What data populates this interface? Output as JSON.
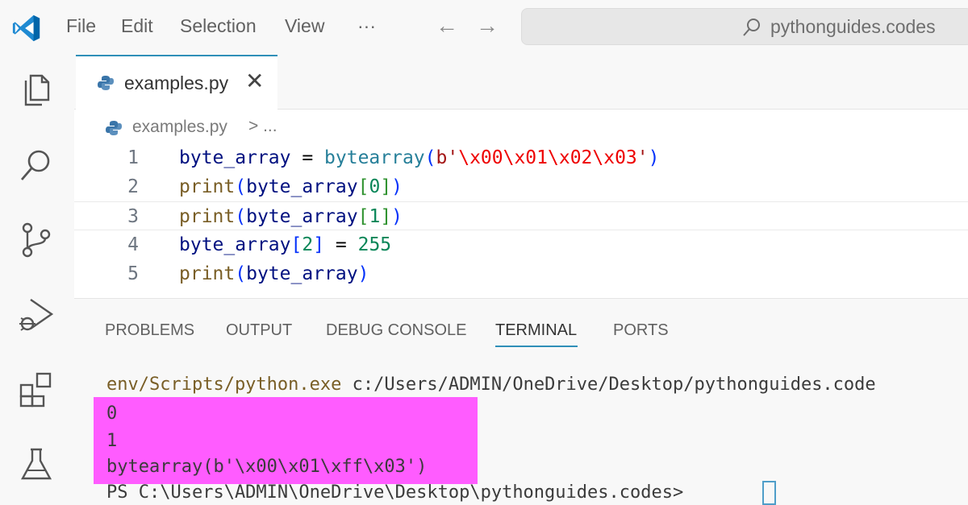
{
  "titlebar": {
    "menu": [
      "File",
      "Edit",
      "Selection",
      "View",
      "···"
    ],
    "back_icon": "←",
    "forward_icon": "→",
    "search_text": "pythonguides.codes"
  },
  "activity_icons": [
    "explorer-icon",
    "search-icon",
    "source-control-icon",
    "run-debug-icon",
    "extensions-icon",
    "testing-icon"
  ],
  "editor": {
    "tab_label": "examples.py",
    "tab_close": "✕",
    "breadcrumb_file": "examples.py",
    "breadcrumb_sep": "> ...",
    "lines": [
      {
        "num": "1"
      },
      {
        "num": "2"
      },
      {
        "num": "3"
      },
      {
        "num": "4"
      },
      {
        "num": "5"
      }
    ],
    "tokens": {
      "l1": [
        "byte_array",
        " = ",
        "bytearray",
        "(",
        "b'",
        "\\x00\\x01\\x02\\x03",
        "'",
        ")"
      ],
      "l2": [
        "print",
        "(",
        "byte_array",
        "[",
        "0",
        "]",
        ")"
      ],
      "l3": [
        "print",
        "(",
        "byte_array",
        "[",
        "1",
        "]",
        ")"
      ],
      "l4": [
        "byte_array",
        "[",
        "2",
        "]",
        " = ",
        "255"
      ],
      "l5": [
        "print",
        "(",
        "byte_array",
        ")"
      ]
    }
  },
  "panel": {
    "tabs": [
      "PROBLEMS",
      "OUTPUT",
      "DEBUG CONSOLE",
      "TERMINAL",
      "PORTS"
    ],
    "active_tab": "TERMINAL",
    "terminal": {
      "cmd_exe": "env/Scripts/python.exe",
      "cmd_path": " c:/Users/ADMIN/OneDrive/Desktop/pythonguides.code",
      "out1": "0",
      "out2": "1",
      "out3": "bytearray(b'\\x00\\x01\\xff\\x03')",
      "prompt": "PS C:\\Users\\ADMIN\\OneDrive\\Desktop\\pythonguides.codes>"
    }
  },
  "colors": {
    "accent": "#2f8fb8",
    "highlight": "#ff4aff",
    "vscode_blue": "#0065a9"
  }
}
